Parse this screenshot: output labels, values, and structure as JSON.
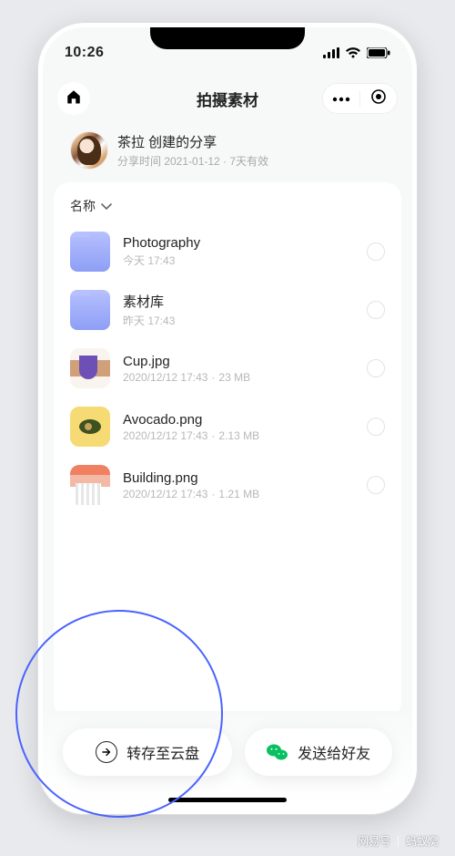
{
  "status": {
    "time": "10:26"
  },
  "nav": {
    "title": "拍摄素材"
  },
  "share": {
    "title": "茶拉 创建的分享",
    "subtitle": "分享时间 2021-01-12 · 7天有效"
  },
  "sort": {
    "label": "名称"
  },
  "items": [
    {
      "kind": "folder",
      "name": "Photography",
      "sub": "今天 17:43",
      "size": ""
    },
    {
      "kind": "folder",
      "name": "素材库",
      "sub": "昨天 17:43",
      "size": ""
    },
    {
      "kind": "file",
      "name": "Cup.jpg",
      "sub": "2020/12/12 17:43",
      "size": "23 MB",
      "thumb": "t-cup"
    },
    {
      "kind": "file",
      "name": "Avocado.png",
      "sub": "2020/12/12 17:43",
      "size": "2.13 MB",
      "thumb": "t-avo"
    },
    {
      "kind": "file",
      "name": "Building.png",
      "sub": "2020/12/12 17:43",
      "size": "1.21 MB",
      "thumb": "t-build"
    }
  ],
  "actions": {
    "primary": "转存至云盘",
    "secondary": "发送给好友"
  },
  "watermark": {
    "brand": "网易号",
    "author": "蚂蚁窝"
  }
}
